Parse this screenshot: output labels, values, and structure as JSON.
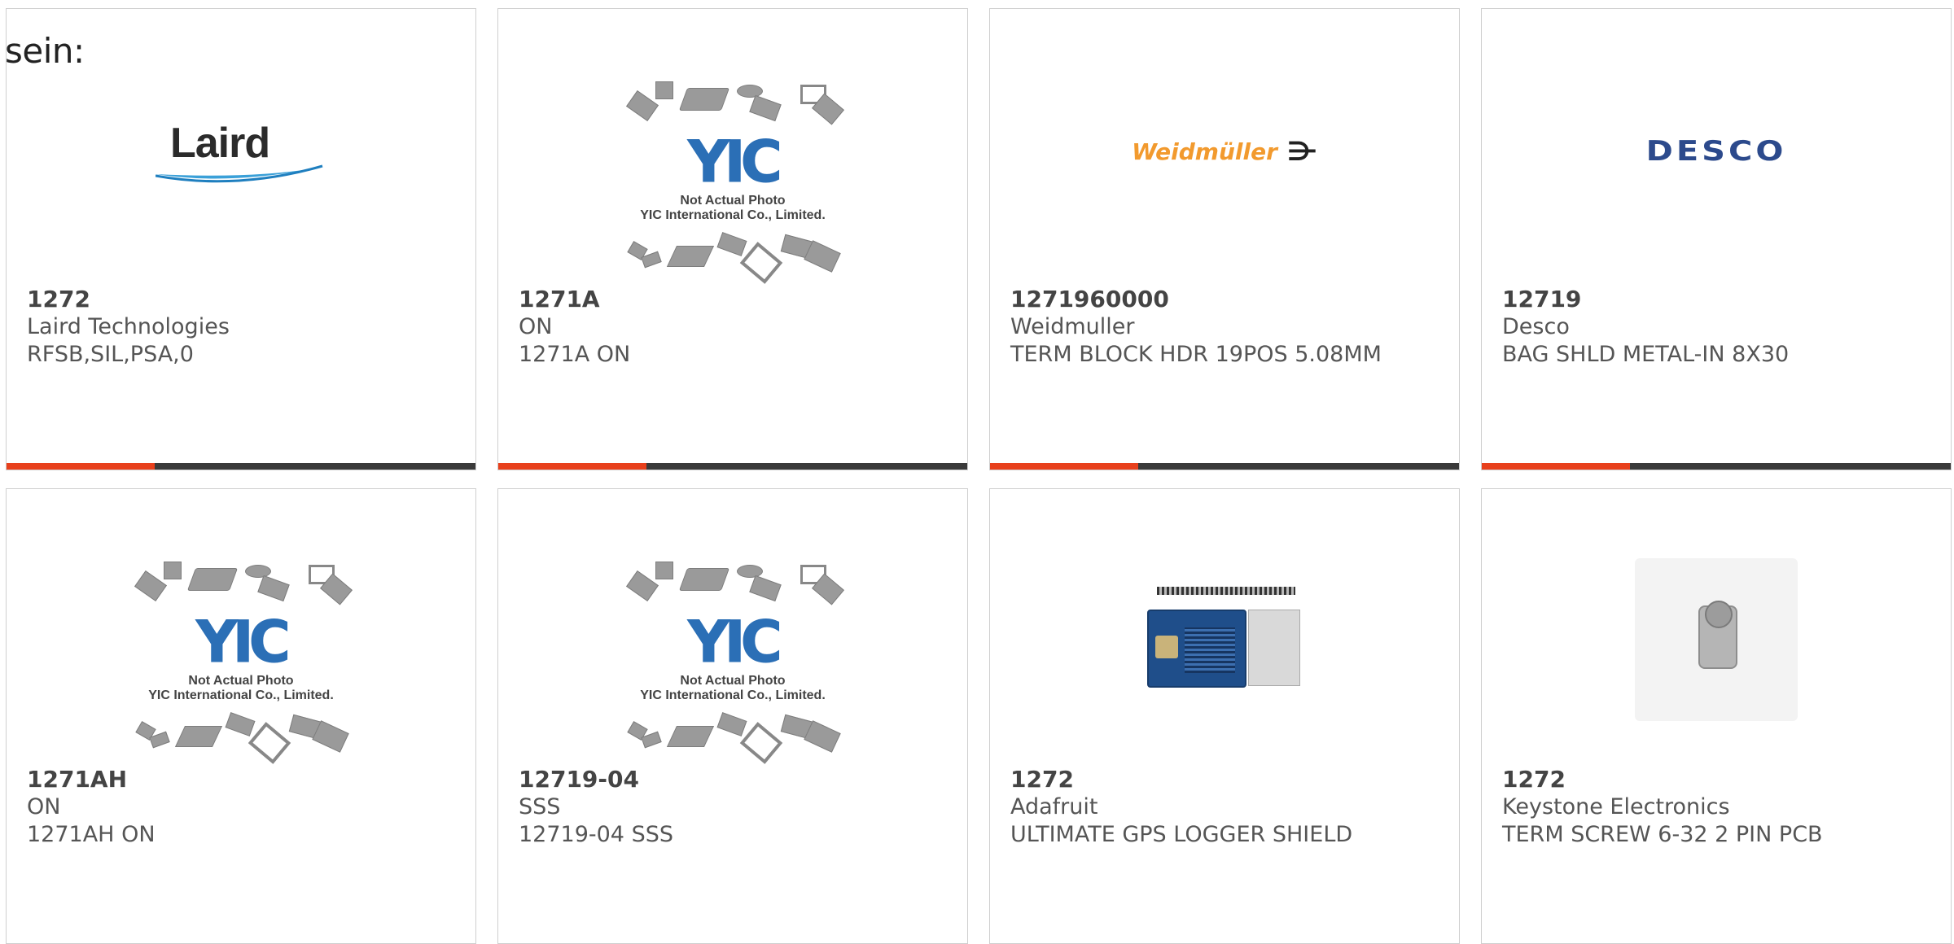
{
  "intro_text": "sein:",
  "accent_color": "#e8401c",
  "cards": [
    {
      "part": "1272",
      "manufacturer": "Laird Technologies",
      "description": "RFSB,SIL,PSA,0",
      "image": "laird-logo"
    },
    {
      "part": "1271A",
      "manufacturer": "ON",
      "description": "1271A ON",
      "image": "yic-placeholder"
    },
    {
      "part": "1271960000",
      "manufacturer": "Weidmuller",
      "description": "TERM BLOCK HDR 19POS 5.08MM",
      "image": "weidmuller-logo"
    },
    {
      "part": "12719",
      "manufacturer": "Desco",
      "description": "BAG SHLD METAL-IN 8X30",
      "image": "desco-logo"
    },
    {
      "part": "1271AH",
      "manufacturer": "ON",
      "description": "1271AH ON",
      "image": "yic-placeholder"
    },
    {
      "part": "12719-04",
      "manufacturer": "SSS",
      "description": "12719-04 SSS",
      "image": "yic-placeholder"
    },
    {
      "part": "1272",
      "manufacturer": "Adafruit",
      "description": "ULTIMATE GPS LOGGER SHIELD",
      "image": "gps-shield-photo"
    },
    {
      "part": "1272",
      "manufacturer": "Keystone Electronics",
      "description": "TERM SCREW 6-32 2 PIN PCB",
      "image": "screw-terminal-photo"
    }
  ],
  "logos": {
    "laird": "Laird",
    "weidmuller": "Weidmüller",
    "desco": "DESCO",
    "yic_mono": "YIC",
    "yic_note_1": "Not Actual Photo",
    "yic_note_2": "YIC International Co., Limited."
  }
}
